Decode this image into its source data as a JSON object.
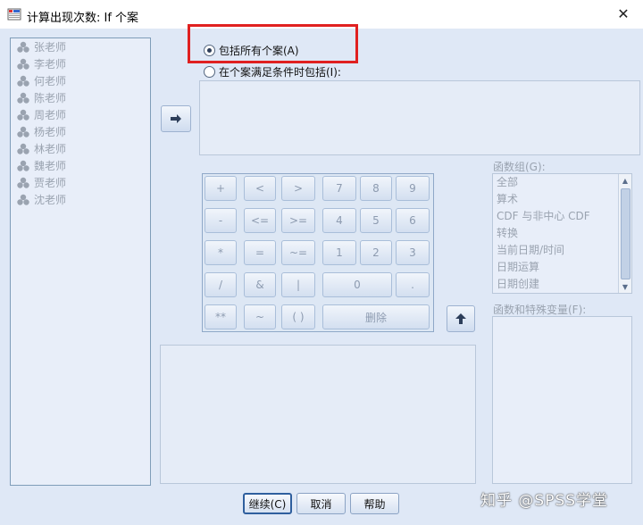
{
  "window": {
    "title": "计算出现次数: If 个案",
    "close_glyph": "✕"
  },
  "variables": [
    "张老师",
    "李老师",
    "何老师",
    "陈老师",
    "周老师",
    "杨老师",
    "林老师",
    "魏老师",
    "贾老师",
    "沈老师"
  ],
  "options": {
    "all_cases": {
      "label": "包括所有个案(A)",
      "selected": true
    },
    "conditional": {
      "label": "在个案满足条件时包括(I):",
      "selected": false
    }
  },
  "keypad": {
    "plus": "+",
    "lt": "<",
    "gt": ">",
    "k7": "7",
    "k8": "8",
    "k9": "9",
    "minus": "-",
    "le": "<=",
    "ge": ">=",
    "k4": "4",
    "k5": "5",
    "k6": "6",
    "mul": "*",
    "eq": "=",
    "ne": "~=",
    "k1": "1",
    "k2": "2",
    "k3": "3",
    "div": "/",
    "and": "&",
    "or": "|",
    "k0": "0",
    "dot": ".",
    "pow": "**",
    "not": "~",
    "paren": "( )",
    "delete": "删除"
  },
  "function_groups": {
    "label": "函数组(G):",
    "items": [
      "全部",
      "算术",
      "CDF 与非中心 CDF",
      "转换",
      "当前日期/时间",
      "日期运算",
      "日期创建"
    ]
  },
  "functions": {
    "label": "函数和特殊变量(F):"
  },
  "buttons": {
    "continue": "继续(C)",
    "cancel": "取消",
    "help": "帮助"
  },
  "watermark": "知乎 @SPSS学堂",
  "colors": {
    "highlight_box": "#e02020"
  }
}
